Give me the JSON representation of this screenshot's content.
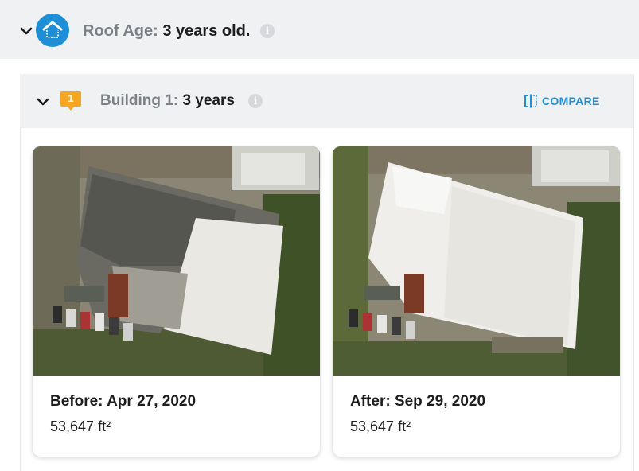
{
  "roof_age": {
    "label": "Roof Age:",
    "value": "3 years old."
  },
  "building": {
    "badge_number": "1",
    "label": "Building 1:",
    "value": "3 years",
    "compare_label": "COMPARE"
  },
  "images": [
    {
      "date_label": "Before: Apr 27, 2020",
      "area_number": "53,647",
      "area_unit": "ft²"
    },
    {
      "date_label": "After: Sep 29, 2020",
      "area_number": "53,647",
      "area_unit": "ft²"
    }
  ],
  "colors": {
    "accent": "#1e8fd6",
    "badge": "#f5a623",
    "row_background": "#f0f1f3",
    "muted_text": "#7b7f86"
  },
  "icons": [
    "chevron-down-icon",
    "house-icon",
    "info-icon",
    "compare-icon",
    "speech-badge-icon"
  ]
}
